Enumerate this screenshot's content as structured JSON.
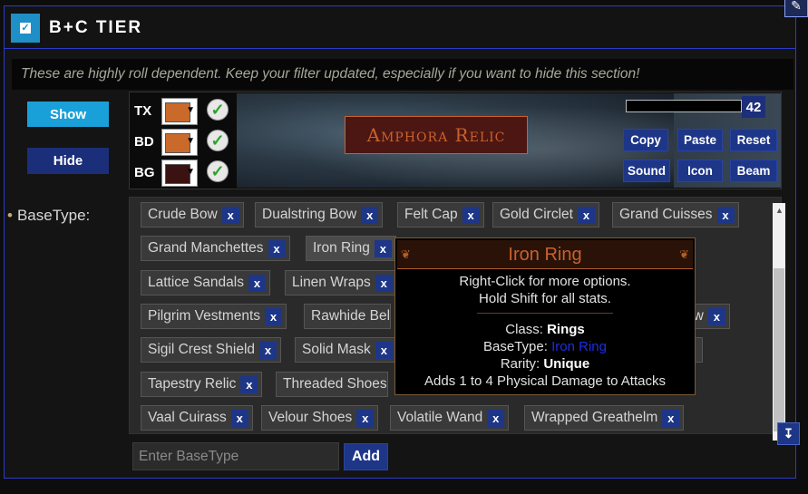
{
  "header": {
    "title": "B+C TIER",
    "checkbox_glyph": "✓",
    "edit_glyph": "✎"
  },
  "note": "These are highly roll dependent. Keep your filter updated, especially if you want to hide this section!",
  "visibility": {
    "show_label": "Show",
    "hide_label": "Hide"
  },
  "basetype_label": "BaseType:",
  "basetype_bullet": "•",
  "colors": {
    "rows": [
      {
        "label": "TX",
        "color": "#c96a2a"
      },
      {
        "label": "BD",
        "color": "#c96a2a"
      },
      {
        "label": "BG",
        "color": "#3a1212"
      }
    ],
    "arrow_glyph": "▼",
    "check_glyph": "✓"
  },
  "preview": {
    "item_name": "Amphora Relic",
    "font_size_value": "42"
  },
  "sound_buttons": {
    "copy": "Copy",
    "paste": "Paste",
    "reset": "Reset",
    "sound": "Sound",
    "icon": "Icon",
    "beam": "Beam"
  },
  "basetypes": [
    "Crude Bow",
    "Dualstring Bow",
    "Felt Cap",
    "Gold Circlet",
    "Grand Cuisses",
    "Grand Manchettes",
    "Iron Ring",
    "Lattice Sandals",
    "Linen Wraps",
    "Pilgrim Vestments",
    "Rawhide Bel",
    "Sigil Crest Shield",
    "Solid Mask",
    "Tapestry Relic",
    "Threaded Shoes",
    "Vaal Cuirass",
    "Velour Shoes",
    "Volatile Wand",
    "Wrapped Greathelm"
  ],
  "partial_tag_text": "ow",
  "remove_glyph": "x",
  "input": {
    "placeholder": "Enter BaseType",
    "add_label": "Add",
    "jump_glyph": "↧"
  },
  "tooltip": {
    "title": "Iron Ring",
    "line1": "Right-Click for more options.",
    "line2": "Hold Shift for all stats.",
    "class_label": "Class:",
    "class_value": "Rings",
    "basetype_label": "BaseType:",
    "basetype_value": "Iron Ring",
    "rarity_label": "Rarity:",
    "rarity_value": "Unique",
    "mod_line": "Adds 1 to 4 Physical Damage to Attacks",
    "ornament_left": "❦",
    "ornament_right": "❦"
  },
  "scroll": {
    "up_glyph": "▲",
    "down_glyph": "▼"
  }
}
